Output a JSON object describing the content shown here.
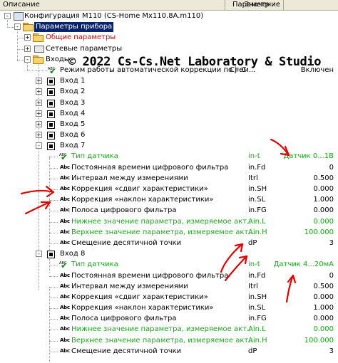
{
  "header": {
    "col_description": "Описание",
    "col_param": "Параметр",
    "col_value": "Значение"
  },
  "watermark": "© 2022 Cs-Cs.Net Laboratory & Studio",
  "tree": {
    "root": {
      "label": "Конфигурация М110 (CS-Home Mx110.8A.m110)",
      "expander": "-"
    },
    "device_params": {
      "label": "Параметры прибора",
      "expander": "-"
    },
    "general": {
      "label": "Общие параметры",
      "expander": "+"
    },
    "network": {
      "label": "Сетевые параметры",
      "expander": "+"
    },
    "inputs": {
      "label": "Входы",
      "expander": "-"
    },
    "auto_corr": {
      "label": "Режим работы автоматической коррекции по тем...",
      "param": "Cj-.C",
      "value": "Включен"
    },
    "vhod1": {
      "label": "Вход 1",
      "expander": "+"
    },
    "vhod2": {
      "label": "Вход 2",
      "expander": "+"
    },
    "vhod3": {
      "label": "Вход 3",
      "expander": "+"
    },
    "vhod4": {
      "label": "Вход 4",
      "expander": "+"
    },
    "vhod5": {
      "label": "Вход 5",
      "expander": "+"
    },
    "vhod6": {
      "label": "Вход 6",
      "expander": "+"
    },
    "vhod7": {
      "label": "Вход 7",
      "expander": "-",
      "rows": [
        {
          "label": "Тип датчика",
          "param": "in-t",
          "value": "Датчик 0...1В",
          "green": true
        },
        {
          "label": "Постоянная времени цифрового фильтра",
          "param": "in.Fd",
          "value": "0",
          "green": false
        },
        {
          "label": "Интервал между измерениями",
          "param": "Itrl",
          "value": "0.500",
          "green": false
        },
        {
          "label": "Коррекция «сдвиг характеристики»",
          "param": "in.SH",
          "value": "0.000",
          "green": false
        },
        {
          "label": "Коррекция «наклон характеристики»",
          "param": "in.SL",
          "value": "1.000",
          "green": false
        },
        {
          "label": "Полоса цифрового фильтра",
          "param": "in.FG",
          "value": "0.000",
          "green": false
        },
        {
          "label": "Нижнее значение параметра, измеряемое акт...",
          "param": "Ain.L",
          "value": "0.000",
          "green": true
        },
        {
          "label": "Верхнее значение параметра, измеряемое акт...",
          "param": "Ain.H",
          "value": "100.000",
          "green": true
        },
        {
          "label": "Смещение десятичной точки",
          "param": "dP",
          "value": "3",
          "green": false
        }
      ]
    },
    "vhod8": {
      "label": "Вход 8",
      "expander": "-",
      "rows": [
        {
          "label": "Тип датчика",
          "param": "in-t",
          "value": "Датчик 4...20мА",
          "green": true
        },
        {
          "label": "Постоянная времени цифрового фильтра",
          "param": "in.Fd",
          "value": "0",
          "green": false
        },
        {
          "label": "Интервал между измерениями",
          "param": "Itrl",
          "value": "0.500",
          "green": false
        },
        {
          "label": "Коррекция «сдвиг характеристики»",
          "param": "in.SH",
          "value": "0.000",
          "green": false
        },
        {
          "label": "Коррекция «наклон характеристики»",
          "param": "in.SL",
          "value": "1.000",
          "green": false
        },
        {
          "label": "Полоса цифрового фильтра",
          "param": "in.FG",
          "value": "0.000",
          "green": false
        },
        {
          "label": "Нижнее значение параметра, измеряемое акт...",
          "param": "Ain.L",
          "value": "0.000",
          "green": true
        },
        {
          "label": "Верхнее значение параметра, измеряемое акт...",
          "param": "Ain.H",
          "value": "100.000",
          "green": true
        },
        {
          "label": "Смещение десятичной точки",
          "param": "dP",
          "value": "3",
          "green": false
        }
      ]
    }
  },
  "icons": {
    "string_param": "Abc",
    "enum_param": "АВС"
  },
  "colors": {
    "green_text": "#1aa81a",
    "red_text": "#e00000",
    "selection": "#0a246a",
    "annotation_arrow": "#e00000"
  }
}
